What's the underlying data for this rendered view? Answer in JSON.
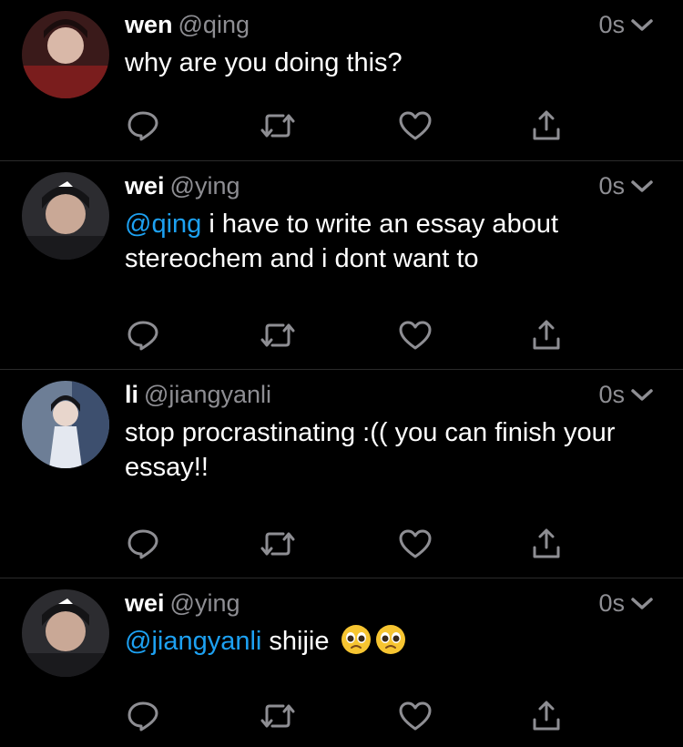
{
  "tweets": [
    {
      "name": "wen",
      "handle": "@qing",
      "time": "0s",
      "mention": "",
      "text": "why are you doing this?",
      "avatar_colors": [
        "#3a1a1a",
        "#7a1d1d"
      ]
    },
    {
      "name": "wei",
      "handle": "@ying",
      "time": "0s",
      "mention": "@qing",
      "text": " i have to write an essay about stereochem and i dont want to",
      "avatar_colors": [
        "#2c2c30",
        "#4a4a50"
      ]
    },
    {
      "name": "li",
      "handle": "@jiangyanli",
      "time": "0s",
      "mention": "",
      "text": "stop procrastinating :(( you can finish your essay!!",
      "avatar_colors": [
        "#6d7e96",
        "#c9d3e3"
      ]
    },
    {
      "name": "wei",
      "handle": "@ying",
      "time": "0s",
      "mention": "@jiangyanli",
      "text": " shijie",
      "emojis": [
        "pleading-face-emoji",
        "pleading-face-emoji"
      ],
      "avatar_colors": [
        "#2c2c30",
        "#4a4a50"
      ]
    }
  ],
  "colors": {
    "background": "#000000",
    "text": "#ffffff",
    "secondary": "#8e8e93",
    "mention": "#1da1f2",
    "divider": "#2b2b2b"
  },
  "icons": [
    "reply-icon",
    "retweet-icon",
    "like-icon",
    "share-icon",
    "chevron-down-icon"
  ]
}
